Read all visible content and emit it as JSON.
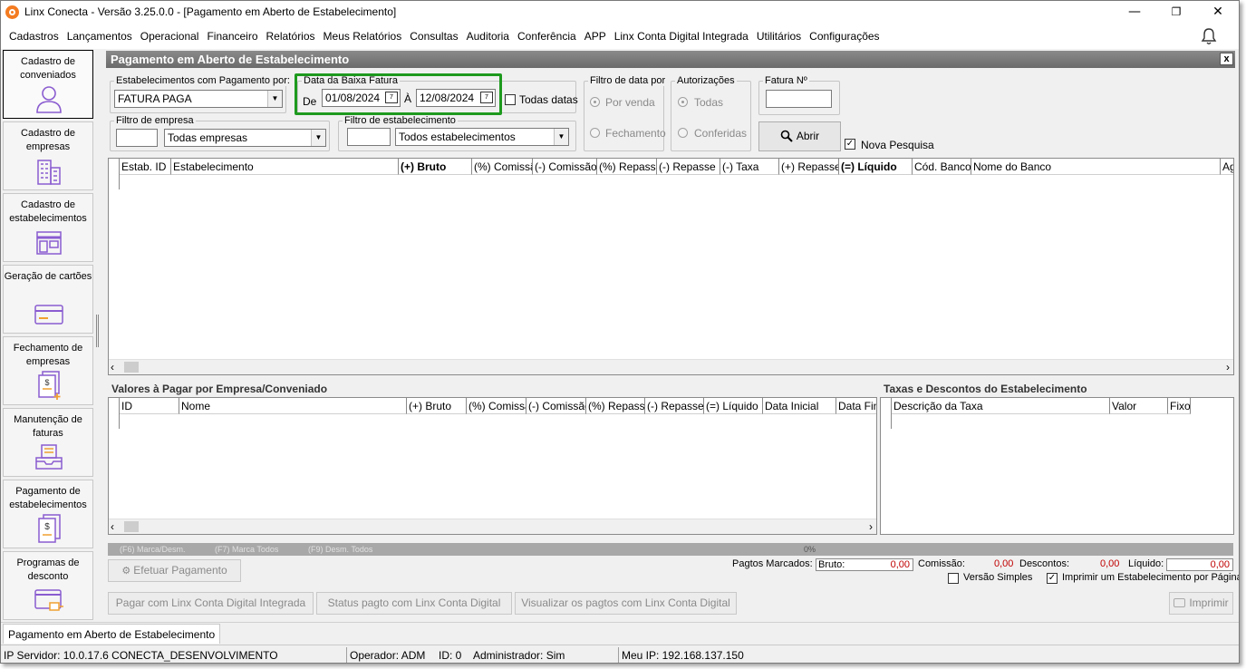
{
  "window": {
    "title": "Linx Conecta - Versão 3.25.0.0 - [Pagamento em Aberto de Estabelecimento]"
  },
  "menu": [
    "Cadastros",
    "Lançamentos",
    "Operacional",
    "Financeiro",
    "Relatórios",
    "Meus Relatórios",
    "Consultas",
    "Auditoria",
    "Conferência",
    "APP",
    "Linx Conta Digital Integrada",
    "Utilitários",
    "Configurações"
  ],
  "sidebar": [
    {
      "label": "Cadastro de conveniados",
      "icon": "user-icon"
    },
    {
      "label": "Cadastro de empresas",
      "icon": "building-icon"
    },
    {
      "label": "Cadastro de estabelecimentos",
      "icon": "store-icon"
    },
    {
      "label": "Geração de cartões",
      "icon": "card-icon"
    },
    {
      "label": "Fechamento de empresas",
      "icon": "invoice-add-icon"
    },
    {
      "label": "Manutenção de faturas",
      "icon": "tray-icon"
    },
    {
      "label": "Pagamento de estabelecimentos",
      "icon": "invoice-icon"
    },
    {
      "label": "Programas de desconto",
      "icon": "discount-card-icon"
    }
  ],
  "panel": {
    "title": "Pagamento em Aberto de Estabelecimento",
    "close_label": "x"
  },
  "filters": {
    "estab_group": "Estabelecimentos com Pagamento por:",
    "estab_value": "FATURA PAGA",
    "date_group": "Data da Baixa Fatura",
    "from_label": "De",
    "from_value": "01/08/2024",
    "to_label": "À",
    "to_value": "12/08/2024",
    "todas_datas": "Todas datas",
    "filtro_data_group": "Filtro de data por",
    "por_venda": "Por venda",
    "fechamento": "Fechamento",
    "autorizacoes_group": "Autorizações",
    "todas": "Todas",
    "conferidas": "Conferidas",
    "fatura_group": "Fatura Nº",
    "empresa_group": "Filtro de empresa",
    "empresa_value": "Todas empresas",
    "estabelecimento_group": "Filtro de estabelecimento",
    "estabelecimento_value": "Todos estabelecimentos",
    "abrir": "Abrir",
    "nova_pesquisa": "Nova Pesquisa"
  },
  "main_grid": {
    "columns": [
      "Estab. ID",
      "Estabelecimento",
      "(+) Bruto",
      "(%) Comissão",
      "(-) Comissão",
      "(%) Repasse",
      "(-) Repasse",
      "(-) Taxa",
      "(+) Repasse",
      "(=) Líquido",
      "Cód. Banco",
      "Nome do Banco",
      "Ag"
    ]
  },
  "valores": {
    "title": "Valores à Pagar por Empresa/Conveniado",
    "columns": [
      "ID",
      "Nome",
      "(+) Bruto",
      "(%) Comissão",
      "(-) Comissão",
      "(%) Repasse",
      "(-) Repasse",
      "(=) Líquido",
      "Data Inicial",
      "Data Final"
    ]
  },
  "taxas": {
    "title": "Taxas e Descontos do Estabelecimento",
    "columns": [
      "Descrição da Taxa",
      "Valor",
      "Fixo"
    ]
  },
  "progress": {
    "f6": "(F6) Marca/Desm.",
    "f7": "(F7) Marca Todos",
    "f9": "(F9) Desm. Todos",
    "percent": "0%"
  },
  "totals": {
    "label": "Pagtos Marcados:",
    "bruto_label": "Bruto:",
    "bruto": "0,00",
    "comissao_label": "Comissão:",
    "comissao": "0,00",
    "descontos_label": "Descontos:",
    "descontos": "0,00",
    "liquido_label": "Líquido:",
    "liquido": "0,00"
  },
  "actions": {
    "efetuar": "Efetuar Pagamento",
    "versao_simples": "Versão Simples",
    "imprimir_um": "Imprimir um Estabelecimento por Página",
    "pagar_linx": "Pagar com Linx Conta Digital Integrada",
    "status_pagto": "Status pagto com Linx Conta Digital",
    "visualizar": "Visualizar os pagtos com Linx Conta Digital",
    "imprimir": "Imprimir"
  },
  "tab": "Pagamento em Aberto de Estabelecimento",
  "status": {
    "servidor": "IP Servidor: 10.0.17.6 CONECTA_DESENVOLVIMENTO",
    "operador": "Operador: ADM",
    "id": "ID: 0",
    "admin": "Administrador: Sim",
    "ip": "Meu IP: 192.168.137.150"
  },
  "colors": {
    "accent": "#8a5cd0",
    "highlight": "#1e9a1e",
    "value_red": "#c00000"
  }
}
